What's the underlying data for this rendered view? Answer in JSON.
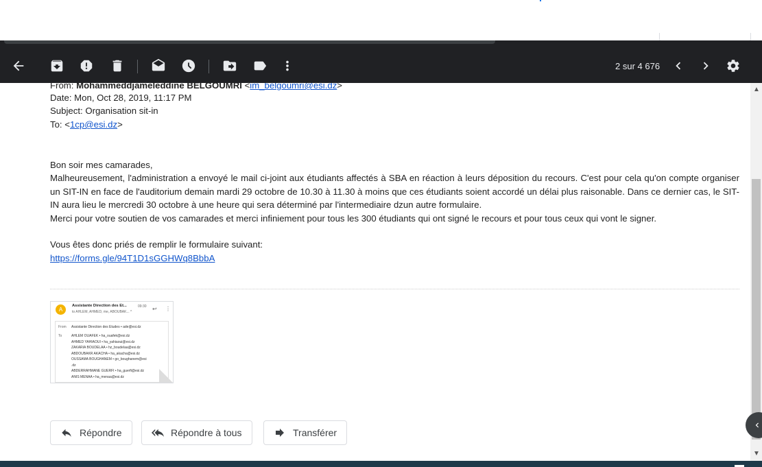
{
  "toolbar": {
    "count": "2 sur 4 676",
    "icons": [
      "back-arrow-icon",
      "archive-icon",
      "report-spam-icon",
      "delete-icon",
      "mark-unread-icon",
      "snooze-icon",
      "move-to-icon",
      "label-icon",
      "more-vert-icon",
      "older-icon",
      "newer-icon",
      "settings-icon"
    ]
  },
  "header": {
    "from_label": "From: ",
    "from_name": "Mohammeddjameleddine BELGOUMRI",
    "from_lt": " <",
    "from_email": "im_belgoumri@esi.dz",
    "from_gt": ">",
    "date": "Date: Mon, Oct 28, 2019, 11:17 PM",
    "subject": "Subject: Organisation sit-in",
    "to_label": "To: <",
    "to_email": "1cp@esi.dz",
    "to_gt": ">"
  },
  "body": {
    "greeting": "Bon soir mes camarades,",
    "para1": "Malheureusement, l'administration a envoyé le mail ci-joint aux étudiants affectés à SBA en réaction à leurs déposition du recours. C'est pour cela qu'on compte organiser un SIT-IN en face de l'auditorium demain mardi 29 octobre de 10.30 à 11.30 à moins que ces étudiants soient accordé un délai plus raisonable. Dans ce dernier cas, le SIT-IN aura lieu le mercredi 30 octobre à une heure qui sera déterminé par l'intermediaire dzun autre formulaire.",
    "para2": "Merci pour votre soutien de vos camarades et merci infiniement pour tous les 300 étudiants qui ont signé le recours et pour tous ceux qui vont le signer.",
    "para3": "Vous êtes donc priés de remplir le formulaire suivant:",
    "link": "https://forms.gle/94T1D1sGGHWq8BbbA"
  },
  "attachment": {
    "avatar_letter": "A",
    "sender": "Assistante Direction des Et...",
    "time": "09:30",
    "to_line": "to AHLEM, AHMED, me, ABOUBAK... ^",
    "from_label": "From",
    "from_value": "Assistante Direction des Etudes • ade@esi.dz",
    "to_label": "To",
    "recipients": [
      "AHLEM OUAFEK • ha_ouafek@esi.dz",
      "AHMED YAHIAOUI • ha_yahiaoui@esi.dz",
      "ZAKARIA BOUDELAA • hz_boudelaa@esi.dz",
      "ABDOUBAKR AKACHA • ha_akacha@esi.dz",
      "OUSSAMA BOUGHANEM • go_boughanem@esi",
      ".dz",
      "ABDERRAHMANE GUERFI • ha_guerfi@esi.dz",
      "ANIS MENAA • ha_menaa@esi.dz"
    ]
  },
  "actions": {
    "reply": "Répondre",
    "reply_all": "Répondre à tous",
    "forward": "Transférer"
  }
}
